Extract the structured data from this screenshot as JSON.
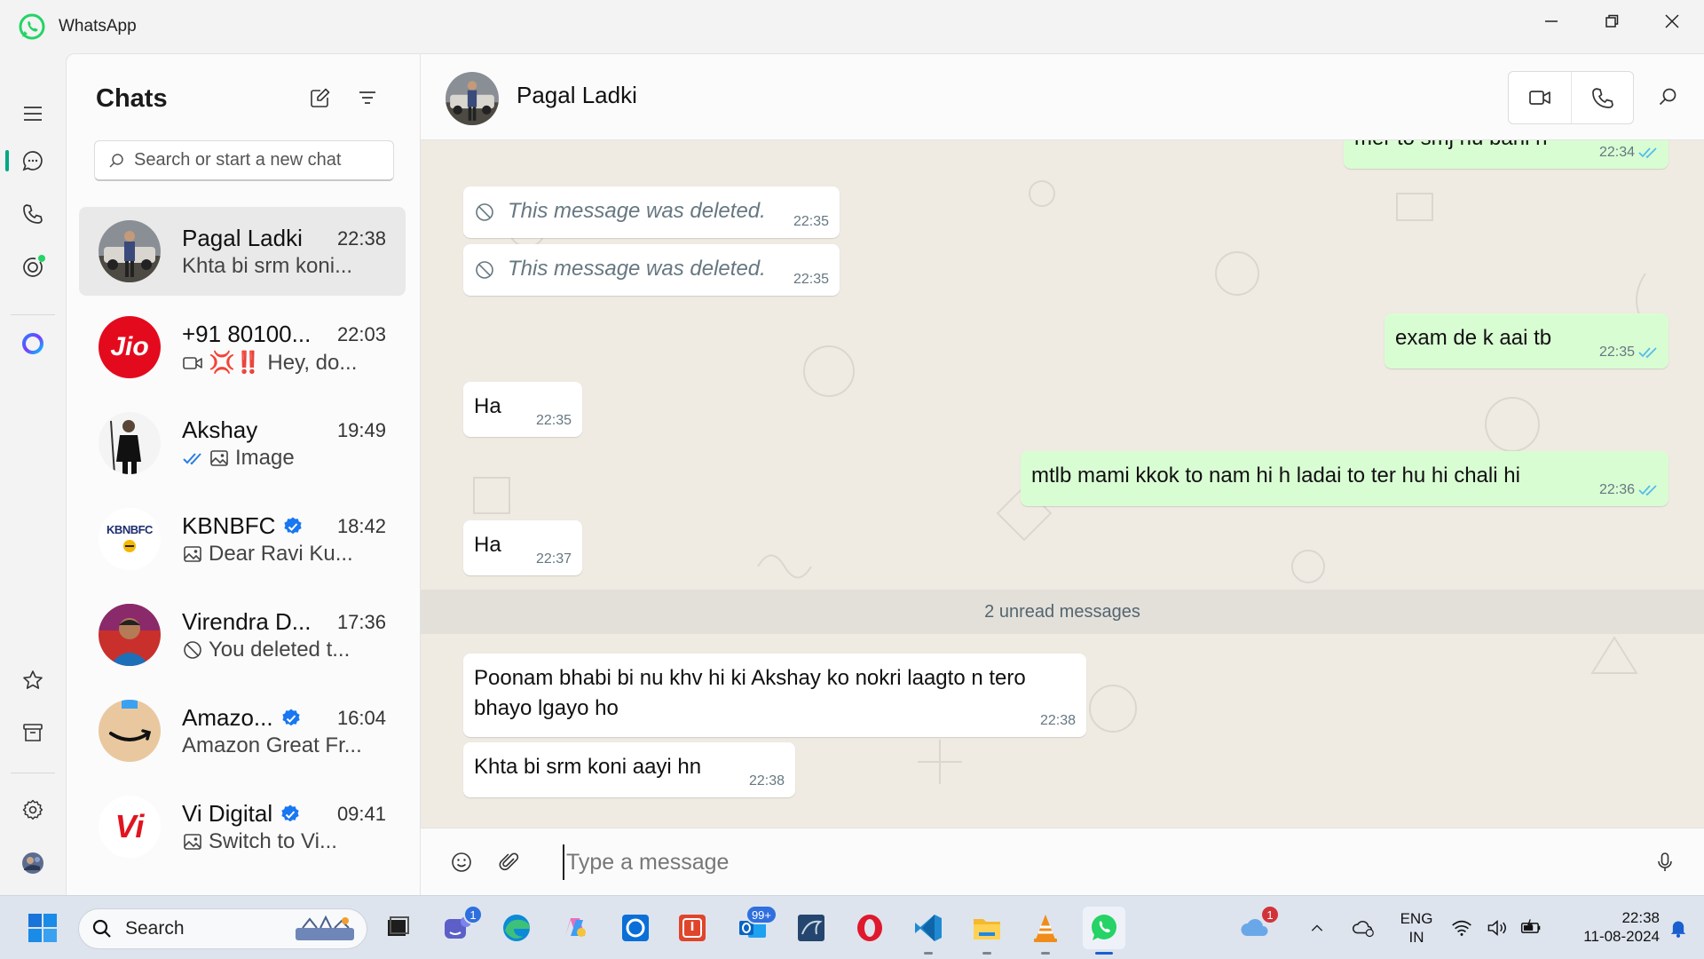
{
  "window": {
    "title": "WhatsApp"
  },
  "chatlist": {
    "heading": "Chats",
    "search_placeholder": "Search or start a new chat",
    "chats": [
      {
        "name": "Pagal Ladki",
        "time": "22:38",
        "preview": "Khta bi srm koni...",
        "verified": false,
        "preview_icon": ""
      },
      {
        "name": "+91 80100...",
        "time": "22:03",
        "preview": "💢‼️ Hey, do...",
        "verified": false,
        "preview_icon": "video-icon"
      },
      {
        "name": "Akshay",
        "time": "19:49",
        "preview": "Image",
        "verified": false,
        "preview_icon": "image-icon",
        "ticks": true
      },
      {
        "name": "KBNBFC",
        "time": "18:42",
        "preview": "Dear Ravi Ku...",
        "verified": true,
        "preview_icon": "image-icon"
      },
      {
        "name": "Virendra D...",
        "time": "17:36",
        "preview": "You deleted t...",
        "verified": false,
        "preview_icon": "ban-icon"
      },
      {
        "name": "Amazo...",
        "time": "16:04",
        "preview": "Amazon Great Fr...",
        "verified": true,
        "preview_icon": ""
      },
      {
        "name": "Vi Digital",
        "time": "09:41",
        "preview": "Switch to Vi...",
        "verified": true,
        "preview_icon": "image-icon"
      }
    ],
    "avatar_texts": {
      "jio": "Jio",
      "kbnbfc": "KBNBFC",
      "vi": "Vi"
    }
  },
  "conversation": {
    "contact_name": "Pagal Ladki",
    "messages": [
      {
        "dir": "out",
        "text": "mer to smj nu bani h",
        "time": "22:34",
        "ticks": true
      },
      {
        "dir": "in",
        "text": "This message was deleted.",
        "time": "22:35",
        "deleted": true
      },
      {
        "dir": "in",
        "text": "This message was deleted.",
        "time": "22:35",
        "deleted": true
      },
      {
        "dir": "out",
        "text": "exam de k aai tb",
        "time": "22:35",
        "ticks": true
      },
      {
        "dir": "in",
        "text": "Ha",
        "time": "22:35"
      },
      {
        "dir": "out",
        "text": "mtlb mami kkok to nam hi h ladai to ter hu hi chali hi",
        "time": "22:36",
        "ticks": true
      },
      {
        "dir": "in",
        "text": "Ha",
        "time": "22:37"
      },
      {
        "dir": "in",
        "text_line1": "Poonam bhabi bi nu khv hi ki Akshay ko nokri laagto n tero",
        "text_line2": "bhayo lgayo ho",
        "time": "22:38"
      },
      {
        "dir": "in",
        "text": "Khta bi srm koni aayi hn",
        "time": "22:38"
      }
    ],
    "unread_label": "2 unread messages",
    "composer_placeholder": "Type a message"
  },
  "taskbar": {
    "search_label": "Search",
    "teams_badge": "1",
    "outlook_badge": "99+",
    "weather_badge": "1",
    "lang_line1": "ENG",
    "lang_line2": "IN",
    "clock_time": "22:38",
    "clock_date": "11-08-2024"
  },
  "colors": {
    "accent": "#00a884",
    "outgoing_bubble": "#d9fdd3",
    "incoming_bubble": "#ffffff",
    "chat_background": "#efeae2",
    "tick_blue": "#53bdeb"
  }
}
